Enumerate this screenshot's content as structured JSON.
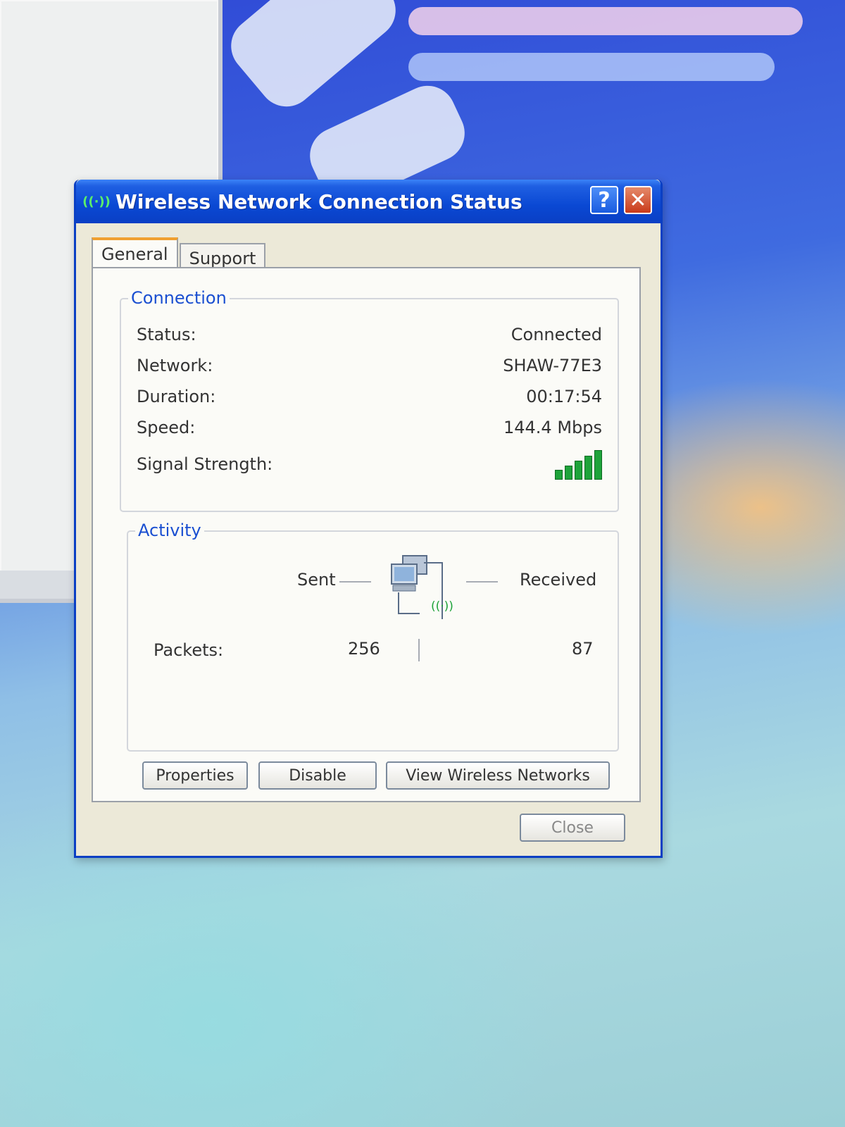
{
  "dialog": {
    "title": "Wireless Network Connection Status",
    "help_label": "?",
    "close_x_label": "✕",
    "icon_glyph": "((·))"
  },
  "tabs": [
    {
      "label": "General",
      "active": true
    },
    {
      "label": "Support",
      "active": false
    }
  ],
  "connection": {
    "legend": "Connection",
    "status_label": "Status:",
    "status_value": "Connected",
    "network_label": "Network:",
    "network_value": "SHAW-77E3",
    "duration_label": "Duration:",
    "duration_value": "00:17:54",
    "speed_label": "Speed:",
    "speed_value": "144.4 Mbps",
    "signal_label": "Signal Strength:",
    "signal_bars_total": 5,
    "signal_bars_lit": 5,
    "signal_icon": "signal-strength-icon"
  },
  "activity": {
    "legend": "Activity",
    "sent_label": "Sent",
    "received_label": "Received",
    "packets_label": "Packets:",
    "packets_sent": "256",
    "packets_received": "87",
    "wireless_glyph": "((·))",
    "computers_icon": "network-computers-icon"
  },
  "buttons": {
    "properties": "Properties",
    "disable": "Disable",
    "view_networks": "View Wireless Networks",
    "close": "Close"
  },
  "colors": {
    "title_bar": "#0a48d3",
    "legend_text": "#1a4fd1",
    "signal_green": "#1ea33a",
    "close_button_red": "#c93a1a"
  }
}
